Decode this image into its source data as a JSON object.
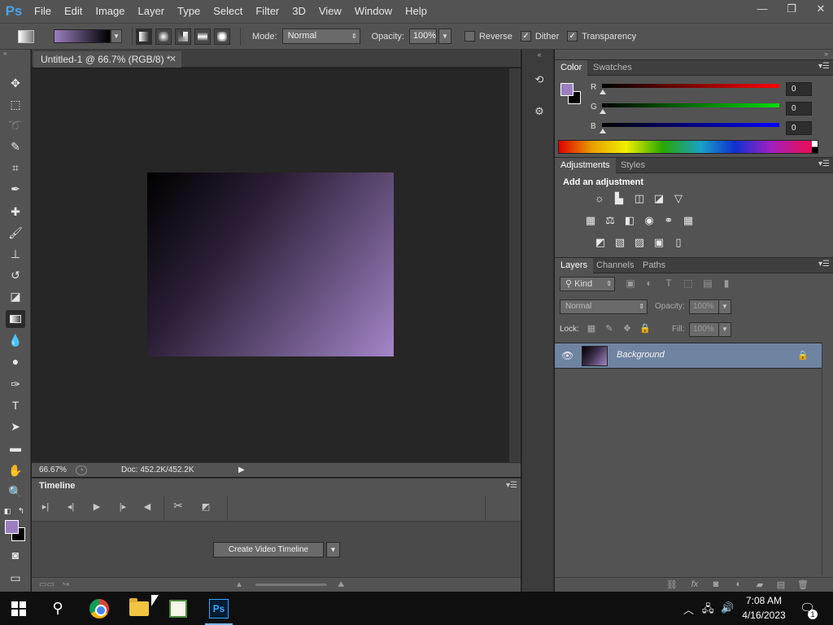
{
  "app": {
    "logo": "Ps"
  },
  "menu": [
    "File",
    "Edit",
    "Image",
    "Layer",
    "Type",
    "Select",
    "Filter",
    "3D",
    "View",
    "Window",
    "Help"
  ],
  "window_controls": {
    "minimize": "—",
    "restore": "❐",
    "close": "✕"
  },
  "options": {
    "mode_label": "Mode:",
    "mode_value": "Normal",
    "opacity_label": "Opacity:",
    "opacity_value": "100%",
    "reverse_label": "Reverse",
    "reverse_checked": false,
    "dither_label": "Dither",
    "dither_checked": true,
    "transparency_label": "Transparency",
    "transparency_checked": true,
    "gradient_colors": [
      "#9b7fc0",
      "#000000"
    ]
  },
  "document": {
    "tab_title": "Untitled-1 @ 66.7% (RGB/8) *",
    "zoom": "66.67%",
    "doc_info": "Doc: 452.2K/452.2K"
  },
  "timeline": {
    "title": "Timeline",
    "create_button": "Create Video Timeline"
  },
  "tools": [
    "move-tool",
    "marquee-tool",
    "lasso-tool",
    "quick-selection-tool",
    "crop-tool",
    "eyedropper-tool",
    "healing-brush-tool",
    "brush-tool",
    "clone-stamp-tool",
    "history-brush-tool",
    "eraser-tool",
    "gradient-tool",
    "blur-tool",
    "dodge-tool",
    "pen-tool",
    "type-tool",
    "path-selection-tool",
    "rectangle-tool",
    "hand-tool",
    "zoom-tool"
  ],
  "colors": {
    "foreground": "#9b7fc0",
    "background": "#000000",
    "layer_highlight": "#6f84a1"
  },
  "color_panel": {
    "tabs": [
      "Color",
      "Swatches"
    ],
    "channels": [
      {
        "label": "R",
        "value": "0",
        "color": "#d00000"
      },
      {
        "label": "G",
        "value": "0",
        "color": "#00b000"
      },
      {
        "label": "B",
        "value": "0",
        "color": "#0000d0"
      }
    ]
  },
  "adjustments_panel": {
    "tabs": [
      "Adjustments",
      "Styles"
    ],
    "title": "Add an adjustment"
  },
  "layers_panel": {
    "tabs": [
      "Layers",
      "Channels",
      "Paths"
    ],
    "filter_label": "Kind",
    "blend_mode": "Normal",
    "opacity_label": "Opacity:",
    "opacity_value": "100%",
    "lock_label": "Lock:",
    "fill_label": "Fill:",
    "fill_value": "100%",
    "layers": [
      {
        "name": "Background",
        "locked": true,
        "visible": true
      }
    ]
  },
  "taskbar": {
    "time": "7:08 AM",
    "date": "4/16/2023",
    "notification_count": "1"
  }
}
